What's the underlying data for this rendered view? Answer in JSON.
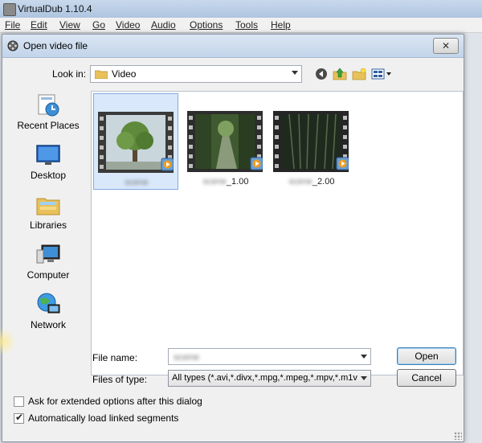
{
  "app": {
    "title": "VirtualDub 1.10.4",
    "menu": [
      "File",
      "Edit",
      "View",
      "Go",
      "Video",
      "Audio",
      "Options",
      "Tools",
      "Help"
    ]
  },
  "dialog": {
    "title": "Open video file",
    "close_glyph": "✕",
    "look_in_label": "Look in:",
    "look_in_value": "Video",
    "places": [
      {
        "label": "Recent Places",
        "icon": "recent-places-icon"
      },
      {
        "label": "Desktop",
        "icon": "desktop-icon"
      },
      {
        "label": "Libraries",
        "icon": "libraries-icon"
      },
      {
        "label": "Computer",
        "icon": "computer-icon"
      },
      {
        "label": "Network",
        "icon": "network-icon"
      }
    ],
    "files": [
      {
        "name_blurred": "scene",
        "name_suffix": "",
        "selected": true,
        "thumb": "tree"
      },
      {
        "name_blurred": "scene",
        "name_suffix": "_1.00",
        "selected": false,
        "thumb": "forest-path"
      },
      {
        "name_blurred": "scene",
        "name_suffix": "_2.00",
        "selected": false,
        "thumb": "dark-forest"
      }
    ],
    "file_name_label": "File name:",
    "file_name_value": "scene",
    "files_of_type_label": "Files of type:",
    "files_of_type_value": "All types (*.avi,*.divx,*.mpg,*.mpeg,*.mpv,*.m1v",
    "open_button": "Open",
    "cancel_button": "Cancel",
    "ask_options_label": "Ask for extended options after this dialog",
    "ask_options_checked": false,
    "auto_load_label": "Automatically load linked segments",
    "auto_load_checked": true
  }
}
